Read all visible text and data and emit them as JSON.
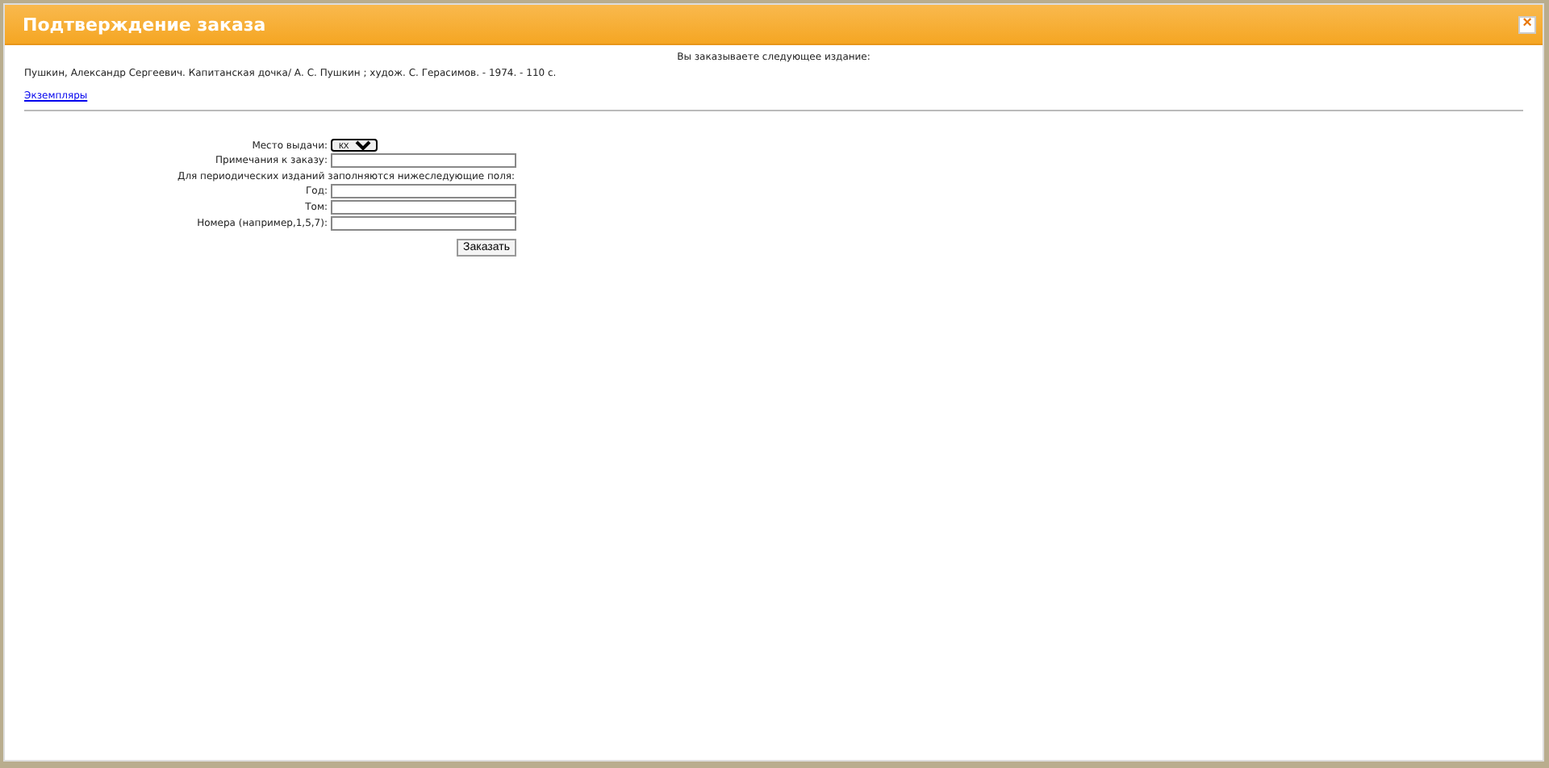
{
  "dialog": {
    "title": "Подтверждение заказа",
    "close": "×"
  },
  "intro": "Вы заказываете следующее издание:",
  "record": "Пушкин, Александр Сергеевич. Капитанская дочка/ А. С. Пушкин ; худож. С. Герасимов. - 1974. - 110 с.",
  "copies_link": "Экземпляры",
  "form": {
    "place_label": "Место выдачи:",
    "place_value": "КХ",
    "notes_label": "Примечания к заказу:",
    "periodicals_note": "Для периодических изданий заполняются нижеследующие поля:",
    "fields": [
      {
        "label": "Год:"
      },
      {
        "label": "Том:"
      },
      {
        "label": "Номера (например,1,5,7):"
      }
    ],
    "submit": "Заказать"
  }
}
